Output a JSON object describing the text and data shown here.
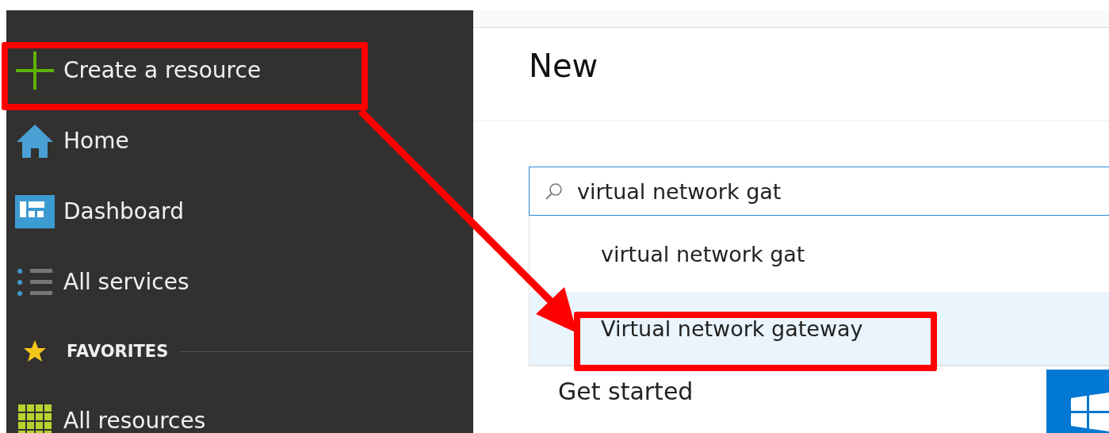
{
  "sidebar": {
    "items": [
      {
        "kind": "plus",
        "label": "Create a resource"
      },
      {
        "kind": "home",
        "label": "Home"
      },
      {
        "kind": "dashboard",
        "label": "Dashboard"
      },
      {
        "kind": "list",
        "label": "All services"
      }
    ],
    "favorites": {
      "label": "FAVORITES",
      "items": [
        {
          "kind": "grid",
          "label": "All resources"
        }
      ]
    }
  },
  "panel": {
    "title": "New",
    "search": {
      "value": "virtual network gat"
    },
    "suggestions": [
      {
        "label": "virtual network gat",
        "selected": false
      },
      {
        "label": "Virtual network gateway",
        "selected": true
      }
    ],
    "section": "Get started"
  }
}
